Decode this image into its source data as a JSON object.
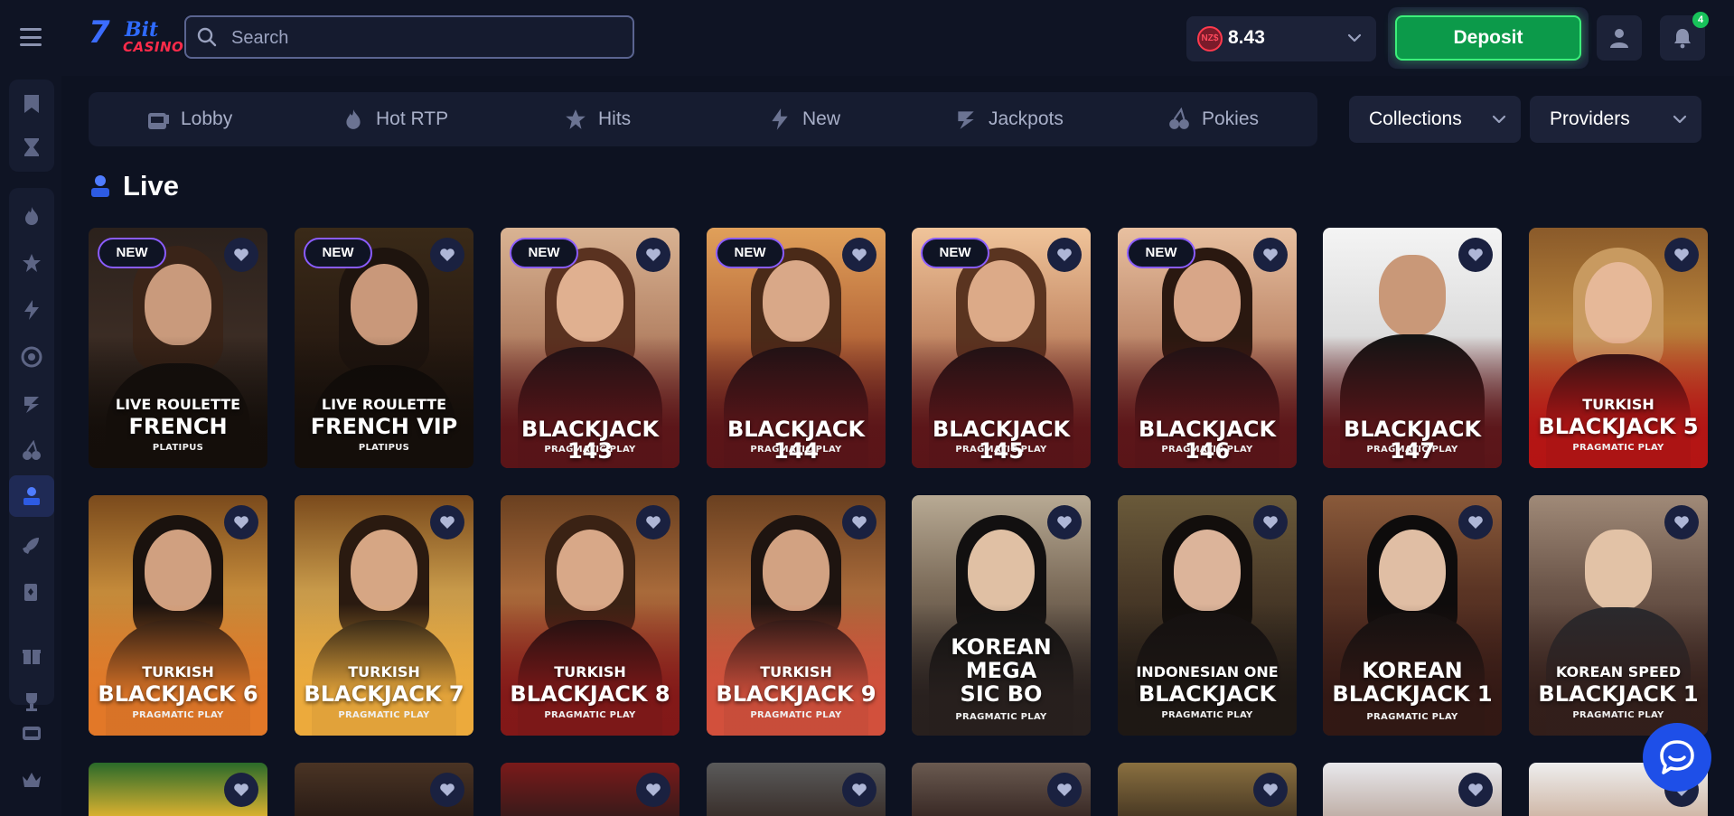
{
  "header": {
    "logo": {
      "num": "7",
      "bit": "Bit",
      "casino": "CASINO"
    },
    "search_placeholder": "Search",
    "balance": {
      "currency": "NZ$",
      "amount": "8.43"
    },
    "deposit_label": "Deposit",
    "notification_count": "4"
  },
  "nav": {
    "categories": [
      {
        "label": "Lobby",
        "icon": "slot-machine-icon"
      },
      {
        "label": "Hot RTP",
        "icon": "flame-icon"
      },
      {
        "label": "Hits",
        "icon": "stars-icon"
      },
      {
        "label": "New",
        "icon": "lightning-icon"
      },
      {
        "label": "Jackpots",
        "icon": "jackpot-icon"
      },
      {
        "label": "Pokies",
        "icon": "cherries-icon"
      }
    ],
    "collections_label": "Collections",
    "providers_label": "Providers"
  },
  "section": {
    "title": "Live"
  },
  "new_badge": "NEW",
  "games_row1": [
    {
      "top": "LIVE ROULETTE",
      "main": "FRENCH",
      "provider": "PLATIPUS",
      "new": true
    },
    {
      "top": "LIVE ROULETTE",
      "main": "FRENCH VIP",
      "provider": "PLATIPUS",
      "new": true
    },
    {
      "top": "",
      "main": "BLACKJACK 143",
      "provider": "PRAGMATIC PLAY",
      "new": true
    },
    {
      "top": "",
      "main": "BLACKJACK 144",
      "provider": "PRAGMATIC PLAY",
      "new": true
    },
    {
      "top": "",
      "main": "BLACKJACK 145",
      "provider": "PRAGMATIC PLAY",
      "new": true
    },
    {
      "top": "",
      "main": "BLACKJACK 146",
      "provider": "PRAGMATIC PLAY",
      "new": true
    },
    {
      "top": "",
      "main": "BLACKJACK 147",
      "provider": "PRAGMATIC PLAY",
      "new": false
    },
    {
      "top": "TURKISH",
      "main": "BLACKJACK 5",
      "provider": "PRAGMATIC PLAY",
      "new": false
    }
  ],
  "games_row2": [
    {
      "top": "TURKISH",
      "main": "BLACKJACK 6",
      "provider": "PRAGMATIC PLAY"
    },
    {
      "top": "TURKISH",
      "main": "BLACKJACK 7",
      "provider": "PRAGMATIC PLAY"
    },
    {
      "top": "TURKISH",
      "main": "BLACKJACK 8",
      "provider": "PRAGMATIC PLAY"
    },
    {
      "top": "TURKISH",
      "main": "BLACKJACK 9",
      "provider": "PRAGMATIC PLAY"
    },
    {
      "top": "KOREAN",
      "main": "MEGA",
      "extra": "SIC BO",
      "provider": "PRAGMATIC PLAY"
    },
    {
      "top": "INDONESIAN ONE",
      "main": "BLACKJACK",
      "provider": "PRAGMATIC PLAY"
    },
    {
      "top": "KOREAN",
      "main": "BLACKJACK 1",
      "provider": "PRAGMATIC PLAY"
    },
    {
      "top": "KOREAN SPEED",
      "main": "BLACKJACK 1",
      "provider": "PRAGMATIC PLAY"
    }
  ],
  "sidebar_icons": [
    "bookmark-icon",
    "hourglass-icon",
    "flame-icon",
    "stars-icon",
    "lightning-icon",
    "target-icon",
    "jackpot-icon",
    "cherries-icon",
    "live-dealer-icon",
    "rocket-icon",
    "cards-icon",
    "gift-icon",
    "trophy-icon",
    "slot-777-icon",
    "crown-icon"
  ],
  "colors": {
    "background": "#0d1221",
    "panel": "#161c30",
    "deposit_green": "#0c9a4a",
    "new_badge_border": "#8a5cff",
    "chat_blue": "#1e4fe8"
  }
}
